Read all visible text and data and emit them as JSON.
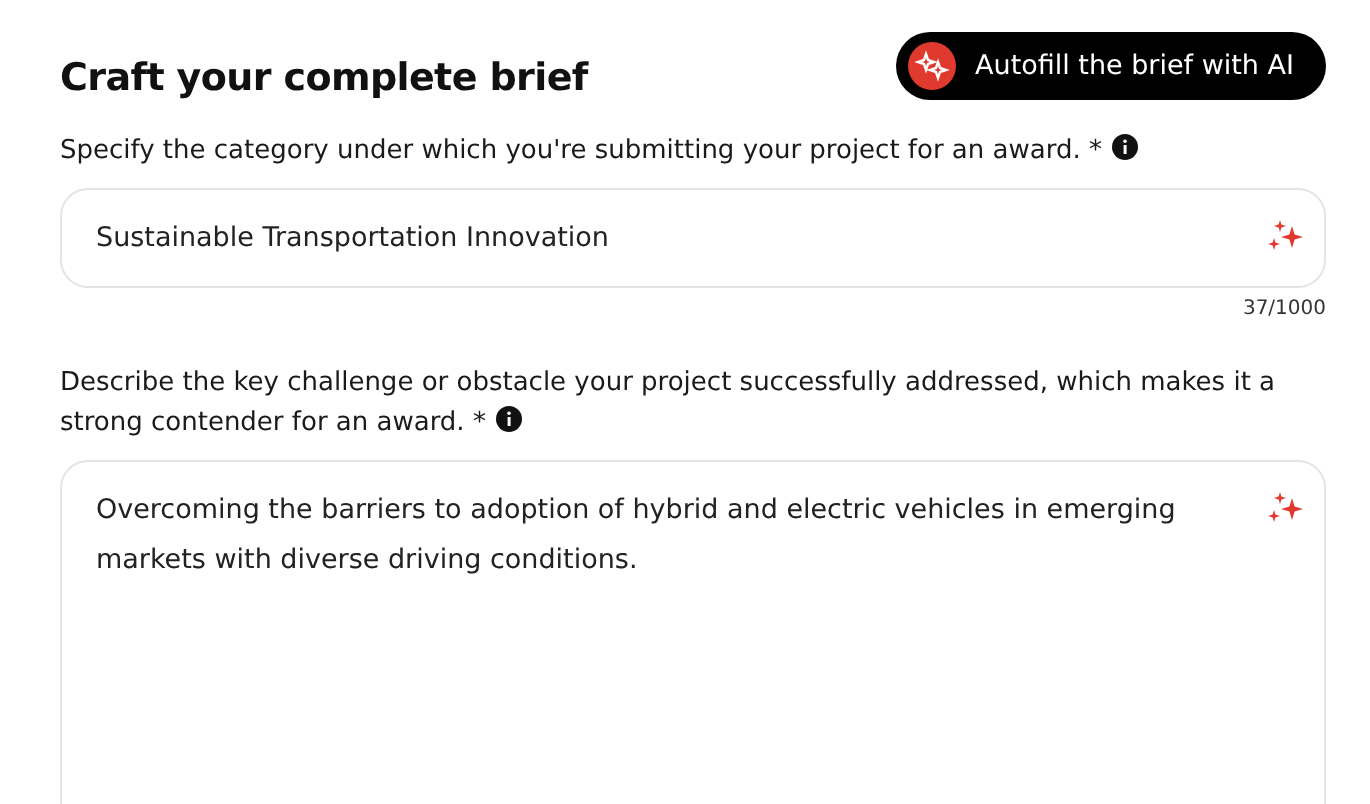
{
  "title": "Craft your complete brief",
  "autofill_button": {
    "label": "Autofill the brief with AI"
  },
  "fields": [
    {
      "kind": "input",
      "label": "Specify the category under which you're submitting your project for an award. *",
      "value": "Sustainable Transportation Innovation",
      "counter": "37/1000"
    },
    {
      "kind": "textarea",
      "label": "Describe the key challenge or obstacle your project successfully addressed, which makes it a strong contender for an award. *",
      "value": "Overcoming the barriers to adoption of hybrid and electric vehicles in emerging markets with diverse driving conditions."
    }
  ]
}
